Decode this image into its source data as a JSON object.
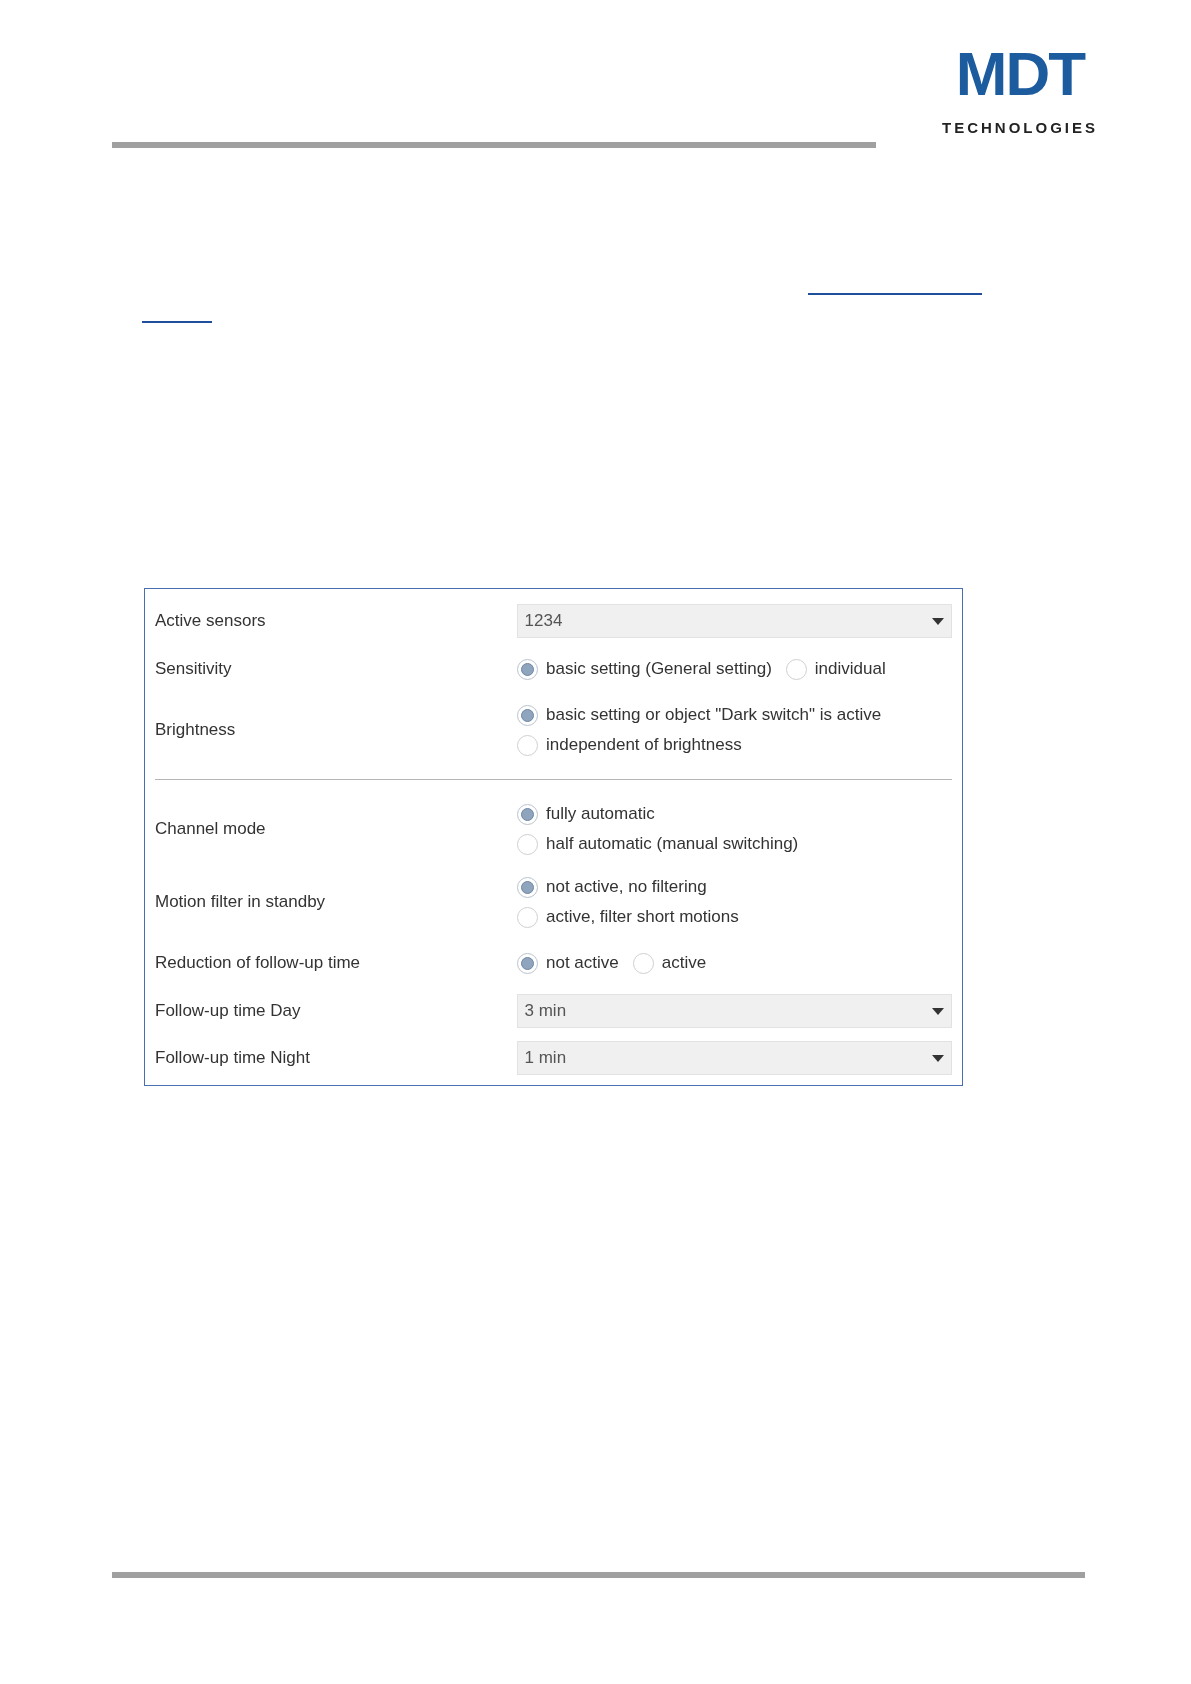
{
  "logo": {
    "mark": "MDT",
    "tagline": "TECHNOLOGIES"
  },
  "settings": [
    {
      "kind": "dropdown",
      "label": "Active sensors",
      "value": "1234"
    },
    {
      "kind": "radio_inline",
      "label": "Sensitivity",
      "options": [
        {
          "label": "basic setting (General setting)",
          "selected": true
        },
        {
          "label": "individual",
          "selected": false
        }
      ]
    },
    {
      "kind": "radio_stacked",
      "label": "Brightness",
      "options": [
        {
          "label": "basic setting or object \"Dark switch\" is active",
          "selected": true
        },
        {
          "label": "independent of brightness",
          "selected": false
        }
      ]
    },
    {
      "kind": "divider"
    },
    {
      "kind": "radio_stacked",
      "label": "Channel mode",
      "options": [
        {
          "label": "fully automatic",
          "selected": true
        },
        {
          "label": "half automatic (manual switching)",
          "selected": false
        }
      ]
    },
    {
      "kind": "radio_stacked",
      "label": "Motion filter in standby",
      "options": [
        {
          "label": "not active, no filtering",
          "selected": true
        },
        {
          "label": "active, filter short motions",
          "selected": false
        }
      ]
    },
    {
      "kind": "radio_inline",
      "label": "Reduction of follow-up time",
      "options": [
        {
          "label": "not active",
          "selected": true
        },
        {
          "label": "active",
          "selected": false
        }
      ]
    },
    {
      "kind": "dropdown",
      "label": "Follow-up time Day",
      "value": "3 min"
    },
    {
      "kind": "dropdown",
      "label": "Follow-up time Night",
      "value": "1 min"
    }
  ]
}
